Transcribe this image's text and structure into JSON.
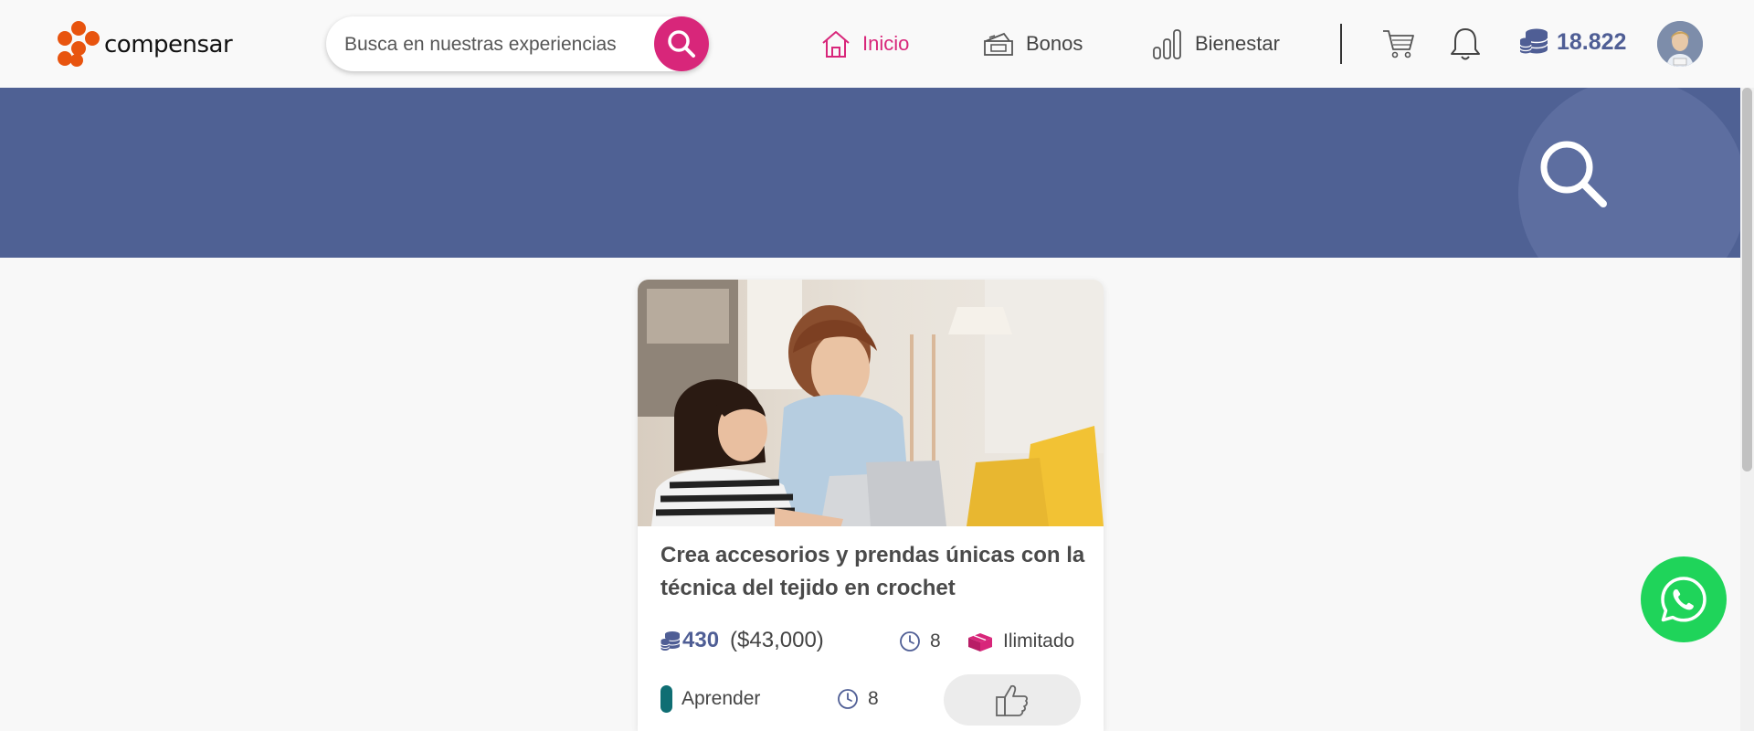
{
  "header": {
    "logo_text": "compensar",
    "search": {
      "placeholder": "Busca en nuestras experiencias",
      "value": ""
    },
    "nav": [
      {
        "label": "Inicio",
        "icon": "home-icon",
        "active": true
      },
      {
        "label": "Bonos",
        "icon": "voucher-icon",
        "active": false
      },
      {
        "label": "Bienestar",
        "icon": "bar-chart-icon",
        "active": false
      }
    ],
    "points_balance": "18.822",
    "accent_color": "#d8267a",
    "brand_color": "#4f6194"
  },
  "banner": {
    "icon": "search-icon"
  },
  "card": {
    "title": "Crea accesorios y prendas únicas con la técnica del tejido en crochet",
    "price_points": "430",
    "price_cop": "($43,000)",
    "duration": "8",
    "availability": "Ilimitado",
    "category": "Aprender",
    "secondary_duration": "8",
    "category_color": "#0f6e73",
    "image": "mother-and-daughter-laptop-photo"
  },
  "floating": {
    "icon": "whatsapp-icon"
  }
}
